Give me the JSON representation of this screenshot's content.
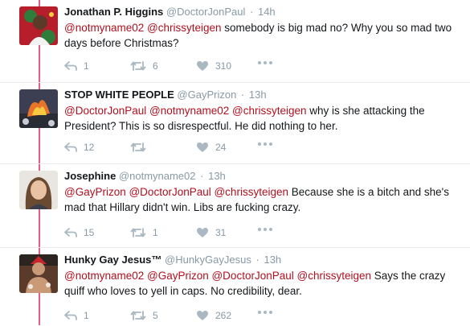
{
  "tweets": [
    {
      "name": "Jonathan P. Higgins",
      "handle": "@DoctorJonPaul",
      "time": "14h",
      "mentions": "@notmyname02 @chrissyteigen",
      "body": "somebody is big mad no? Why you so mad two days before Christmas?",
      "replies": "1",
      "retweets": "6",
      "likes": "310"
    },
    {
      "name": "STOP WHITE PEOPLE",
      "handle": "@GayPrizon",
      "time": "13h",
      "mentions": "@DoctorJonPaul @notmyname02 @chrissyteigen",
      "body": "why is she attacking the President? This is so disrespectful. He did nothing to her.",
      "replies": "12",
      "retweets": "",
      "likes": "24"
    },
    {
      "name": "Josephine",
      "handle": "@notmyname02",
      "time": "13h",
      "mentions": "@GayPrizon @DoctorJonPaul @chrissyteigen",
      "body": "Because she is a bitch and she's mad that Hillary didn't win. Libs are fucking crazy.",
      "replies": "15",
      "retweets": "1",
      "likes": "31"
    },
    {
      "name": "Hunky Gay Jesus™",
      "handle": "@HunkyGayJesus",
      "time": "13h",
      "mentions": "@notmyname02 @GayPrizon @DoctorJonPaul @chrissyteigen",
      "body": "Says the crazy quiff who loves to yell in caps. No credibility, dear.",
      "replies": "1",
      "retweets": "5",
      "likes": "262"
    }
  ],
  "colors": {
    "mention": "#b0101f",
    "thread_line": "#e0245e",
    "meta": "#8899a6"
  },
  "icons": {
    "reply": "reply-icon",
    "retweet": "retweet-icon",
    "like": "heart-icon",
    "more": "more-icon"
  }
}
